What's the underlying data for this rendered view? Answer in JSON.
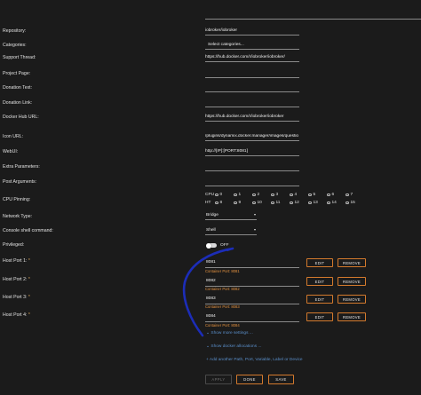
{
  "form": {
    "repository": {
      "label": "Repository:",
      "value": "iobroker/iobroker"
    },
    "categories": {
      "label": "Categories:",
      "value": "Select categories..."
    },
    "support_thread": {
      "label": "Support Thread:",
      "value": "https://hub.docker.com/r/iobroker/iobroker/"
    },
    "project_page": {
      "label": "Project Page:",
      "value": ""
    },
    "donation_text": {
      "label": "Donation Text:",
      "value": ""
    },
    "donation_link": {
      "label": "Donation Link:",
      "value": ""
    },
    "docker_hub_url": {
      "label": "Docker Hub URL:",
      "value": "https://hub.docker.com/r/iobroker/iobroker"
    },
    "icon_url": {
      "label": "Icon URL:",
      "value": "/plugins/dynamix.docker.manager/images/questio"
    },
    "webui": {
      "label": "WebUI:",
      "value": "http://[IP]:[PORT:8081]"
    },
    "extra_parameters": {
      "label": "Extra Parameters:",
      "value": ""
    },
    "post_arguments": {
      "label": "Post Arguments:",
      "value": ""
    },
    "cpu_pinning": {
      "label": "CPU Pinning:",
      "cpu_tag": "CPU",
      "ht_tag": "HT",
      "cpu_cores": [
        "0",
        "1",
        "2",
        "3",
        "4",
        "5",
        "6",
        "7"
      ],
      "ht_cores": [
        "8",
        "9",
        "10",
        "11",
        "12",
        "13",
        "14",
        "15"
      ]
    },
    "network_type": {
      "label": "Network Type:",
      "value": "Bridge"
    },
    "console_shell": {
      "label": "Console shell command:",
      "value": "Shell"
    },
    "privileged": {
      "label": "Privileged:",
      "state": "OFF",
      "on": false
    }
  },
  "ports": [
    {
      "label": "Host Port 1:",
      "value": "8081",
      "hint": "Container Port: 8081"
    },
    {
      "label": "Host Port 2:",
      "value": "8082",
      "hint": "Container Port: 8082"
    },
    {
      "label": "Host Port 3:",
      "value": "8083",
      "hint": "Container Port: 8083"
    },
    {
      "label": "Host Port 4:",
      "value": "8084",
      "hint": "Container Port: 8084"
    }
  ],
  "required_mark": "*",
  "port_buttons": {
    "edit": "EDIT",
    "remove": "REMOVE"
  },
  "links": {
    "show_more_settings": "Show more settings ...",
    "show_docker_allocations": "Show docker allocations ...",
    "add_another": "Add another Path, Port, Variable, Label or Device"
  },
  "icons": {
    "show_more": "chevron-down-icon",
    "show_alloc": "chevron-down-icon",
    "add": "plus-icon"
  },
  "actions": {
    "apply": "APPLY",
    "done": "DONE",
    "save": "SAVE"
  },
  "colors": {
    "accent": "#d47a2d",
    "link": "#5a8ec9",
    "annotation": "#1c2db8"
  }
}
